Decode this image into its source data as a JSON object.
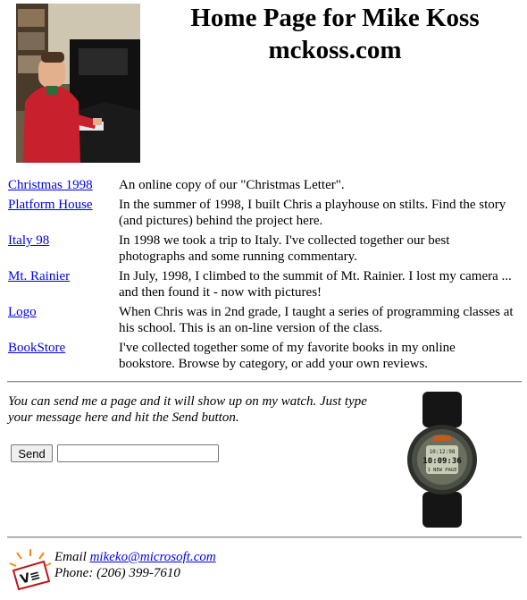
{
  "header": {
    "title_line1": "Home Page for Mike Koss",
    "title_line2": "mckoss.com"
  },
  "links": [
    {
      "label": "Christmas 1998",
      "desc": "An online copy of our \"Christmas Letter\"."
    },
    {
      "label": "Platform House",
      "desc": "In the summer of 1998, I built Chris a playhouse on stilts.  Find the story (and pictures) behind the project here."
    },
    {
      "label": "Italy 98",
      "desc": "In 1998 we took a trip to Italy.  I've collected together our best photographs and some running commentary."
    },
    {
      "label": "Mt. Rainier",
      "desc": "In July, 1998, I climbed to the summit of Mt. Rainier.  I lost my camera ... and then found it - now with pictures!"
    },
    {
      "label": "Logo",
      "desc": "When Chris was in 2nd grade, I taught a series of programming classes at his school.  This is an on-line version of the class."
    },
    {
      "label": "BookStore",
      "desc": "I've collected together some of my favorite books in my online bookstore.   Browse by category, or add your own reviews."
    }
  ],
  "pager": {
    "text": "You can send me a page and it will show up on my watch.   Just type your message here and hit the Send button.",
    "send_label": "Send",
    "input_value": "",
    "watch_time": "10:09:36",
    "watch_top": "10:12:98",
    "watch_label": "1 NEW PAGE"
  },
  "contact": {
    "email_label": "Email",
    "email": "mikeko@microsoft.com",
    "phone_label": "Phone:",
    "phone": "(206) 399-7610"
  },
  "colors": {
    "link": "#0000ee",
    "sweater": "#c8202c",
    "logo_orange": "#f08a1c"
  },
  "icons": [
    "portrait-photo",
    "pager-watch-image",
    "logo-icon"
  ]
}
